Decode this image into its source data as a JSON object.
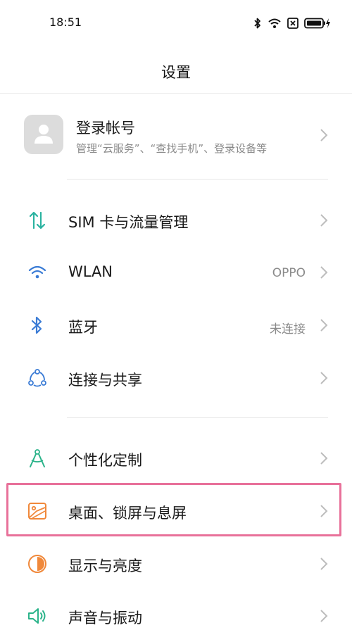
{
  "status_bar": {
    "time": "18:51",
    "icons": [
      "bluetooth-icon",
      "wifi-icon",
      "no-sim-icon",
      "battery-charging-icon"
    ]
  },
  "header": {
    "title": "设置"
  },
  "account": {
    "title": "登录帐号",
    "subtitle": "管理“云服务”、“查找手机”、登录设备等",
    "icon": "avatar-icon"
  },
  "settings_items": [
    {
      "label": "SIM 卡与流量管理",
      "value": "",
      "icon": "sim-data-icon",
      "color": "#2bb3a0"
    },
    {
      "label": "WLAN",
      "value": "OPPO",
      "icon": "wifi-icon",
      "color": "#3a7bd5"
    },
    {
      "label": "蓝牙",
      "value": "未连接",
      "icon": "bluetooth-icon",
      "color": "#3a7bd5"
    },
    {
      "label": "连接与共享",
      "value": "",
      "icon": "share-connection-icon",
      "color": "#3a7bd5"
    },
    {
      "label": "个性化定制",
      "value": "",
      "icon": "compass-icon",
      "color": "#2bb38a"
    },
    {
      "label": "桌面、锁屏与息屏",
      "value": "",
      "icon": "wallpaper-icon",
      "color": "#f0883a"
    },
    {
      "label": "显示与亮度",
      "value": "",
      "icon": "brightness-icon",
      "color": "#f0883a"
    },
    {
      "label": "声音与振动",
      "value": "",
      "icon": "speaker-icon",
      "color": "#2bb38a"
    }
  ],
  "highlight_color": "#e8719a"
}
